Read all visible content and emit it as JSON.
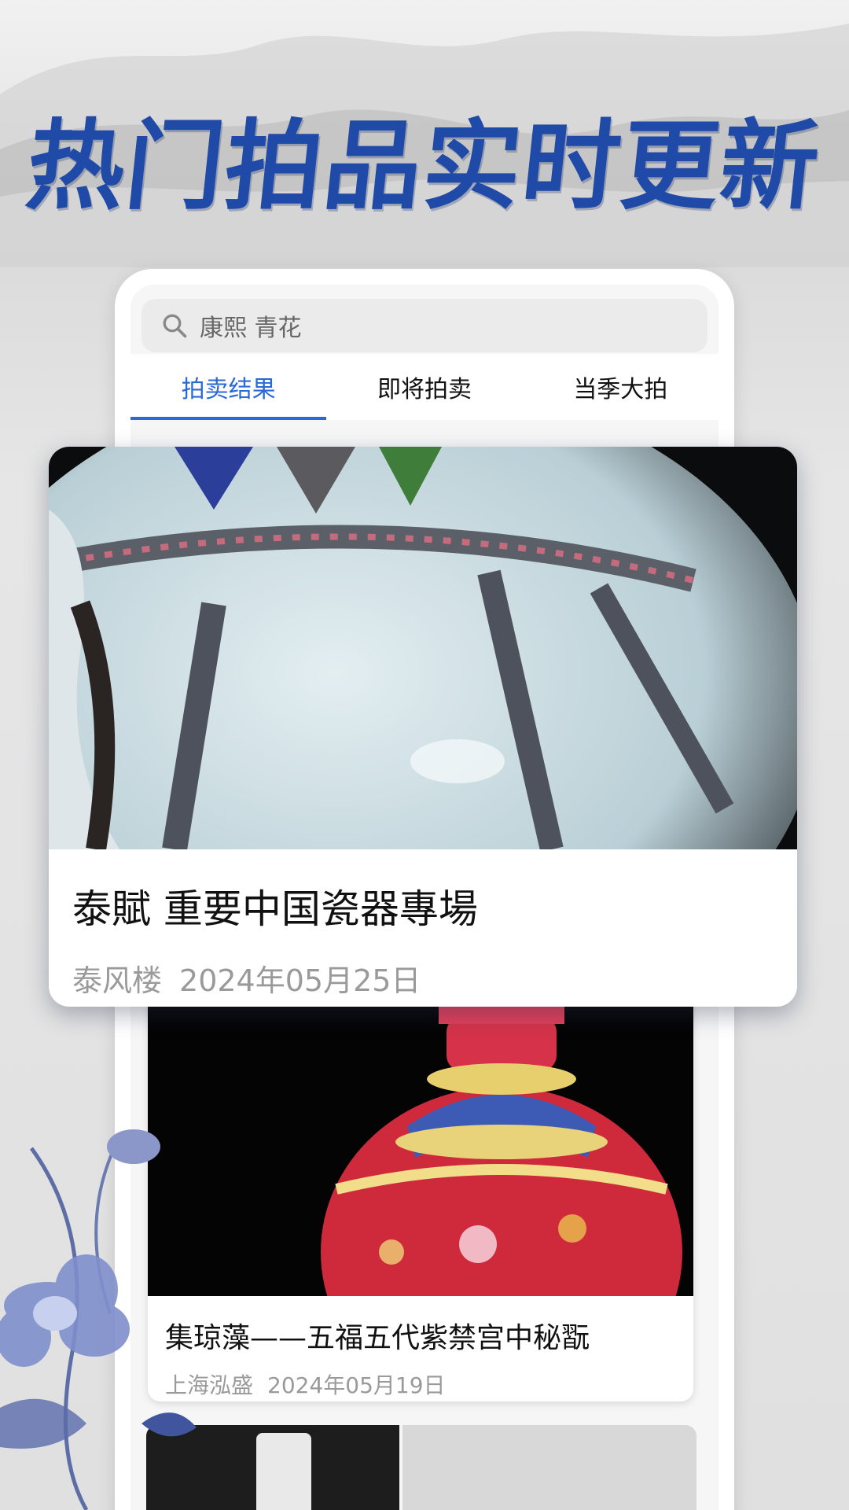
{
  "headline": "热门拍品实时更新",
  "search": {
    "text": "康熙 青花"
  },
  "tabs": [
    {
      "label": "拍卖结果",
      "active": true
    },
    {
      "label": "即将拍卖",
      "active": false
    },
    {
      "label": "当季大拍",
      "active": false
    }
  ],
  "featured": {
    "title": "泰賦 重要中国瓷器專場",
    "house": "泰风楼",
    "date": "2024年05月25日"
  },
  "card2": {
    "title": "集琼藻——五福五代紫禁宫中秘翫",
    "house": "上海泓盛",
    "date": "2024年05月19日"
  },
  "colors": {
    "accent": "#2a6ad6",
    "headline": "#1f4aa8"
  }
}
